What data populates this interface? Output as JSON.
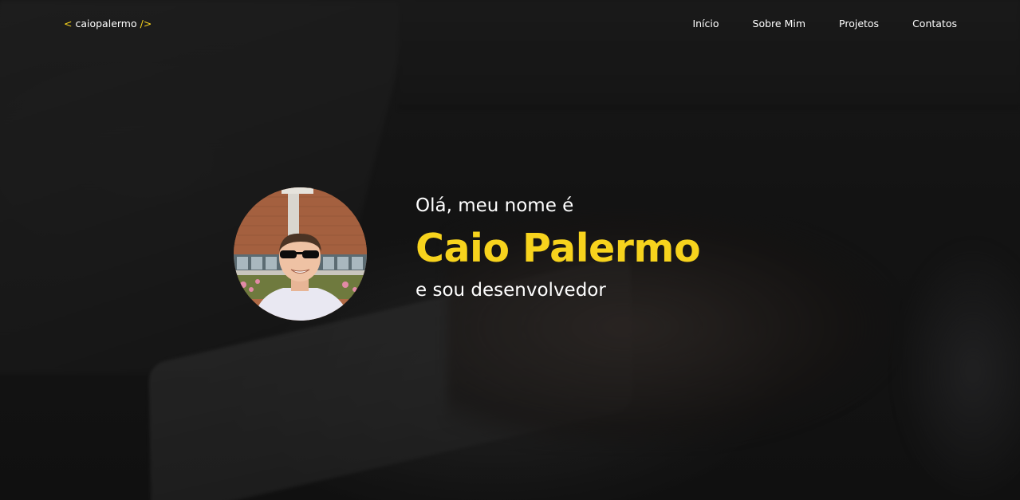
{
  "nav": {
    "logo": {
      "open": "<",
      "text": "caiopalermo",
      "close": "/>"
    },
    "links": [
      "Início",
      "Sobre Mim",
      "Projetos",
      "Contatos"
    ]
  },
  "hero": {
    "greeting": "Olá, meu nome é",
    "name": "Caio Palermo",
    "role": "e sou desenvolvedor",
    "avatar_icon": "profile-photo"
  },
  "colors": {
    "accent": "#f7d31d",
    "text": "#ffffff",
    "background": "#161616"
  }
}
